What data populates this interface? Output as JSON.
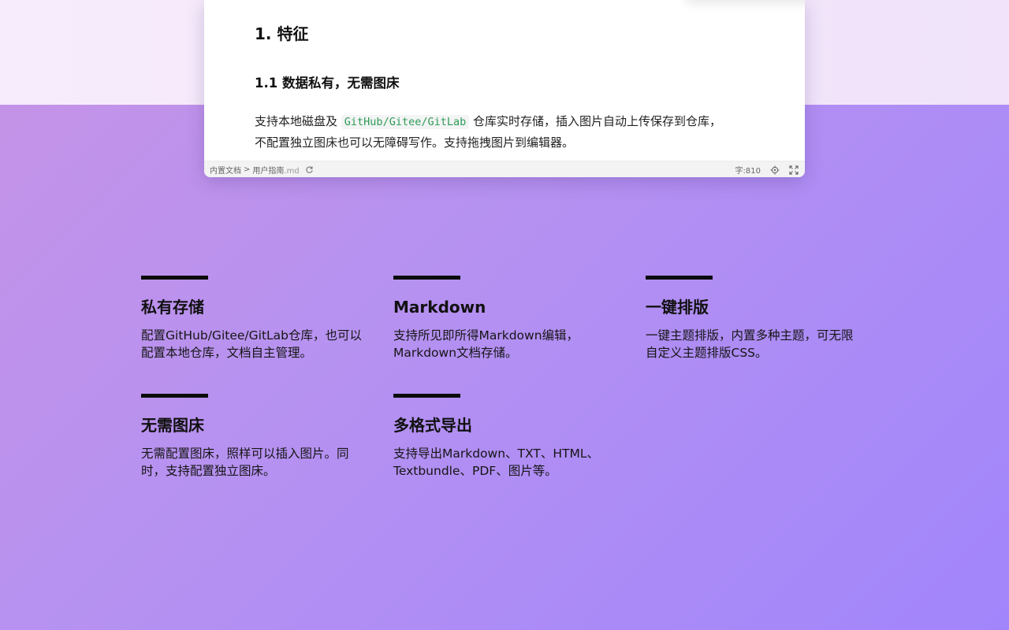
{
  "document": {
    "heading1": "1. 特征",
    "heading2": "1.1 数据私有，无需图床",
    "paragraph": {
      "line1_before": "支持本地磁盘及",
      "code": "GitHub/Gitee/GitLab",
      "line1_after": "仓库实时存储，插入图片自动上传保存到仓库，",
      "line2": "不配置独立图床也可以无障碍写作。支持拖拽图片到编辑器。"
    }
  },
  "status_bar": {
    "breadcrumb_folder": "内置文档",
    "breadcrumb_separator": ">",
    "breadcrumb_file": "用户指南",
    "breadcrumb_ext": ".md",
    "word_count": "字:810",
    "icons": [
      "refresh-icon",
      "locate-icon",
      "fullscreen-icon"
    ]
  },
  "features": [
    {
      "title": "私有存储",
      "desc": [
        "配置GitHub/Gitee/GitLab仓库，也可以",
        "配置本地仓库，文档自主管理。"
      ]
    },
    {
      "title": "Markdown",
      "desc": [
        "支持所见即所得Markdown编辑，",
        "Markdown文档存储。"
      ]
    },
    {
      "title": "一键排版",
      "desc": [
        "一键主题排版，内置多种主题，可无限",
        "自定义主题排版CSS。"
      ]
    },
    {
      "title": "无需图床",
      "desc": [
        "无需配置图床，照样可以插入图片。同",
        "时，支持配置独立图床。"
      ]
    },
    {
      "title": "多格式导出",
      "desc": [
        "支持导出Markdown、TXT、HTML、",
        "Textbundle、PDF、图片等。"
      ]
    }
  ],
  "colors": {
    "code_text": "#2e9b57",
    "feature_bar": "#0b0b0b",
    "background_start": "#c693e6",
    "background_end": "#a185fb"
  }
}
